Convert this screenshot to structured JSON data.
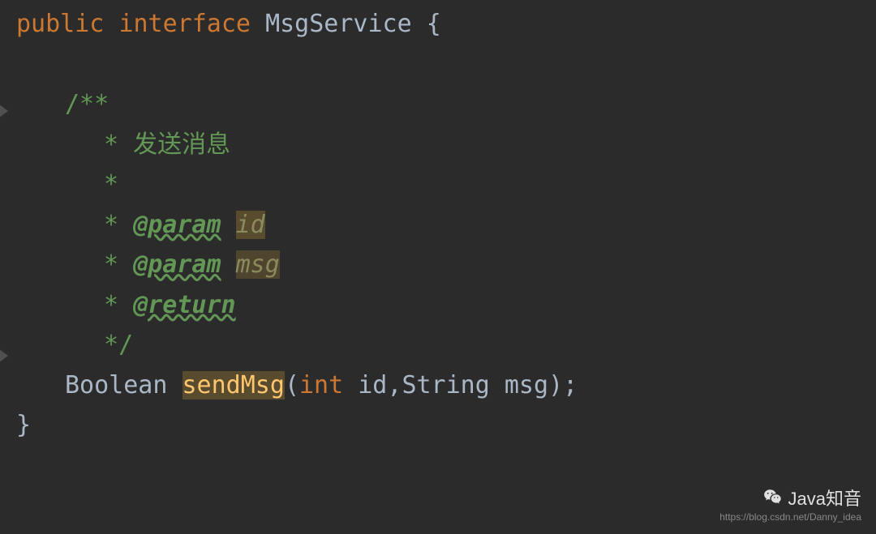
{
  "code": {
    "kw_public": "public",
    "kw_interface": "interface",
    "class_name": "MsgService",
    "brace_open": " {",
    "brace_close": "}",
    "doc_open": "/**",
    "doc_desc": " * 发送消息",
    "doc_empty": " *",
    "doc_star": " * ",
    "tag_param": "@param",
    "tag_return": "@return",
    "param1": "id",
    "param2": "msg",
    "doc_close": " */",
    "return_type": "Boolean ",
    "method": "sendMsg",
    "paren_open": "(",
    "kw_int": "int",
    "arg1": " id,",
    "arg_string": "String",
    "arg2": " msg",
    "paren_close": ");",
    "space": " "
  },
  "watermark": {
    "top": "Java知音",
    "bottom": "https://blog.csdn.net/Danny_idea"
  }
}
